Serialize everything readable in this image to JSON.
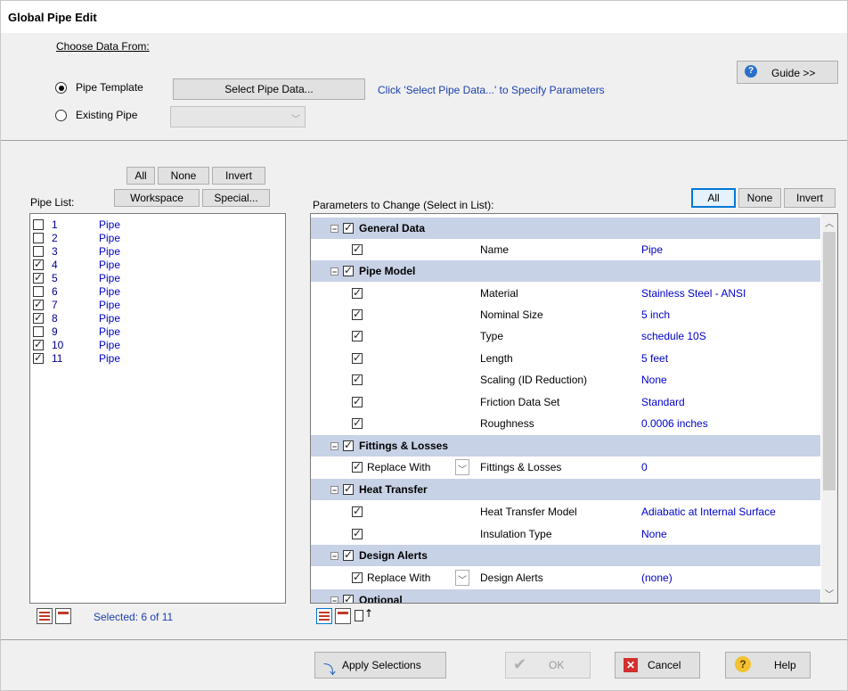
{
  "window": {
    "title": "Global Pipe Edit"
  },
  "source": {
    "heading": "Choose Data From:",
    "pipe_template_label": "Pipe Template",
    "existing_pipe_label": "Existing Pipe",
    "select_button": "Select Pipe Data...",
    "hint": "Click 'Select Pipe Data...' to Specify Parameters",
    "guide_button": "Guide >>"
  },
  "pipe_list": {
    "label": "Pipe List:",
    "buttons": {
      "all": "All",
      "none": "None",
      "invert": "Invert",
      "workspace": "Workspace",
      "special": "Special..."
    },
    "items": [
      {
        "num": "1",
        "name": "Pipe",
        "checked": false
      },
      {
        "num": "2",
        "name": "Pipe",
        "checked": false
      },
      {
        "num": "3",
        "name": "Pipe",
        "checked": false
      },
      {
        "num": "4",
        "name": "Pipe",
        "checked": true
      },
      {
        "num": "5",
        "name": "Pipe",
        "checked": true
      },
      {
        "num": "6",
        "name": "Pipe",
        "checked": false
      },
      {
        "num": "7",
        "name": "Pipe",
        "checked": true
      },
      {
        "num": "8",
        "name": "Pipe",
        "checked": true
      },
      {
        "num": "9",
        "name": "Pipe",
        "checked": false
      },
      {
        "num": "10",
        "name": "Pipe",
        "checked": true
      },
      {
        "num": "11",
        "name": "Pipe",
        "checked": true
      }
    ],
    "selected_text": "Selected: 6 of 11"
  },
  "params": {
    "label": "Parameters to Change (Select in List):",
    "buttons": {
      "all": "All",
      "none": "None",
      "invert": "Invert"
    },
    "groups": {
      "general": {
        "title": "General Data",
        "name_label": "Name",
        "name_value": "Pipe"
      },
      "pipe_model": {
        "title": "Pipe Model",
        "rows": [
          {
            "label": "Material",
            "value": "Stainless Steel - ANSI"
          },
          {
            "label": "Nominal Size",
            "value": "5 inch"
          },
          {
            "label": "Type",
            "value": "schedule 10S"
          },
          {
            "label": "Length",
            "value": "5 feet"
          },
          {
            "label": "Scaling (ID Reduction)",
            "value": "None"
          },
          {
            "label": "Friction Data Set",
            "value": "Standard"
          },
          {
            "label": "Roughness",
            "value": "0.0006 inches"
          }
        ]
      },
      "fittings": {
        "title": "Fittings & Losses",
        "replace": "Replace With",
        "label": "Fittings & Losses",
        "value": "0"
      },
      "heat": {
        "title": "Heat Transfer",
        "rows": [
          {
            "label": "Heat Transfer Model",
            "value": "Adiabatic at Internal Surface"
          },
          {
            "label": "Insulation Type",
            "value": "None"
          }
        ]
      },
      "alerts": {
        "title": "Design Alerts",
        "replace": "Replace With",
        "label": "Design Alerts",
        "value": "(none)"
      },
      "optional": {
        "title": "Optional"
      }
    }
  },
  "footer": {
    "apply": "Apply Selections",
    "ok": "OK",
    "cancel": "Cancel",
    "help": "Help"
  },
  "colors": {
    "header_row": "#c8d2e6",
    "value_text": "#0000cc",
    "hint_text": "#1a3fb0"
  }
}
